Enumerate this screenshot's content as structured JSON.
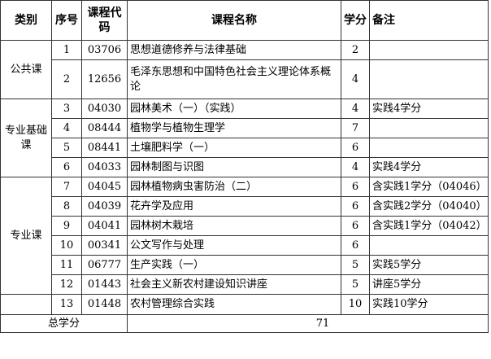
{
  "headers": {
    "category": "类别",
    "number": "序号",
    "code": "课程代码",
    "name": "课程名称",
    "credit": "学分",
    "note": "备注"
  },
  "groups": {
    "public": "公共课",
    "major_basic": "专业基础课",
    "major": "专业课"
  },
  "rows": [
    {
      "no": "1",
      "code": "03706",
      "name": "思想道德修养与法律基础",
      "credit": "2",
      "note": ""
    },
    {
      "no": "2",
      "code": "12656",
      "name": "毛泽东思想和中国特色社会主义理论体系概论",
      "credit": "4",
      "note": ""
    },
    {
      "no": "3",
      "code": "04030",
      "name": "园林美术（一）（实践）",
      "credit": "4",
      "note": "实践4学分"
    },
    {
      "no": "4",
      "code": "08444",
      "name": "植物学与植物生理学",
      "credit": "7",
      "note": ""
    },
    {
      "no": "5",
      "code": "08441",
      "name": "土壤肥料学（一）",
      "credit": "6",
      "note": ""
    },
    {
      "no": "6",
      "code": "04033",
      "name": "园林制图与识图",
      "credit": "4",
      "note": "实践4学分"
    },
    {
      "no": "7",
      "code": "04045",
      "name": "园林植物病虫害防治（二）",
      "credit": "6",
      "note": "含实践1学分（04046）"
    },
    {
      "no": "8",
      "code": "04039",
      "name": "花卉学及应用",
      "credit": "6",
      "note": "含实践2学分（04040）"
    },
    {
      "no": "9",
      "code": "04041",
      "name": "园林树木栽培",
      "credit": "6",
      "note": "含实践1学分（04042）"
    },
    {
      "no": "10",
      "code": "00341",
      "name": "公文写作与处理",
      "credit": "6",
      "note": ""
    },
    {
      "no": "11",
      "code": "06777",
      "name": "生产实践（一）",
      "credit": "5",
      "note": "实践5学分"
    },
    {
      "no": "12",
      "code": "01443",
      "name": "社会主义新农村建设知识讲座",
      "credit": "5",
      "note": "讲座5学分"
    },
    {
      "no": "13",
      "code": "01448",
      "name": "农村管理综合实践",
      "credit": "10",
      "note": "实践10学分"
    }
  ],
  "total": {
    "label": "总学分",
    "value": "71"
  }
}
